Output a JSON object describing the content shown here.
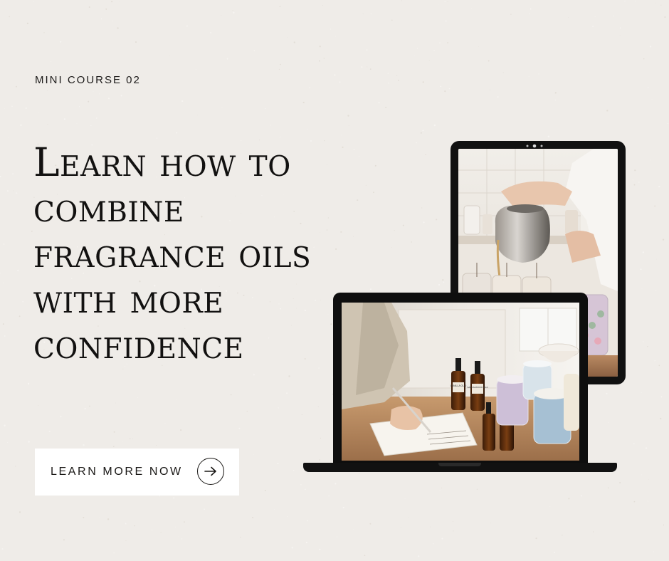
{
  "kicker": "MINI COURSE 02",
  "headline": {
    "lines": [
      "Learn how to",
      "combine",
      "fragrance oils",
      "with more",
      "confidence"
    ]
  },
  "cta": {
    "label": "LEARN MORE NOW",
    "icon": "arrow-right-icon"
  },
  "laptop": {
    "bottle_labels": [
      {
        "text": "VANILLA\nOUD"
      },
      {
        "text": "SANDALWOOD\nMILK"
      }
    ]
  },
  "colors": {
    "background": "#efece8",
    "text": "#121110",
    "device": "#111111",
    "button": "#ffffff"
  }
}
